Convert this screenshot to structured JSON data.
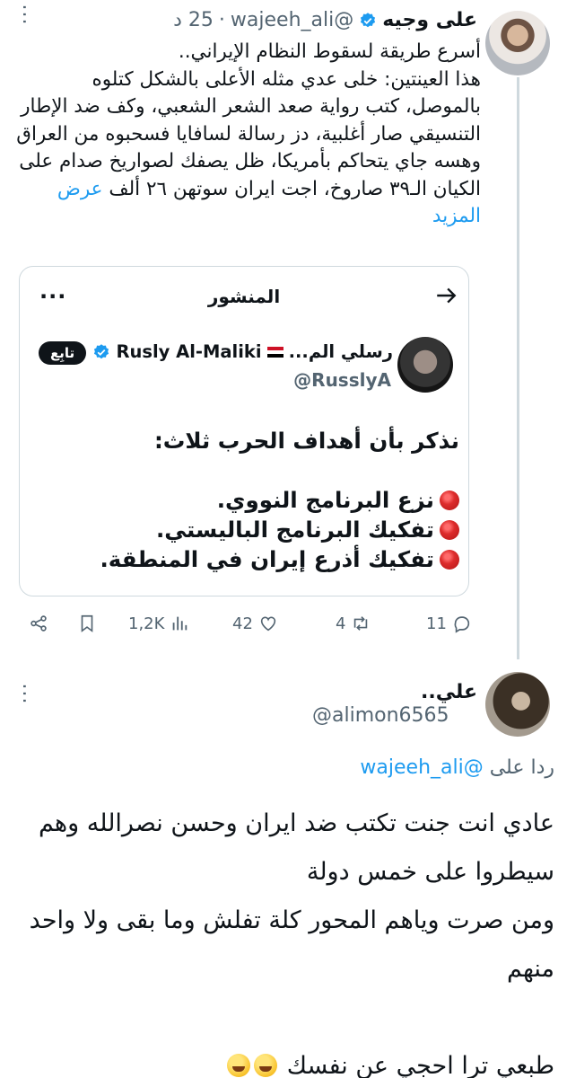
{
  "tweet1": {
    "display_name": "على وجيه",
    "handle": "@wajeeh_ali",
    "separator": "·",
    "time": "25 د",
    "body": "أسرع طريقة لسقوط النظام الإيراني..\nهذا العينتين: خلى عدي مثله الأعلى بالشكل كتلوه بالموصل، كتب رواية صعد الشعر الشعبي، وكف ضد الإطار التنسيقي صار أغلبية، دز رسالة لسافايا فسحبوه من العراق وهسه جاي يتحاكم بأمريكا، ظل يصفك لصواريخ صدام على الكيان الـ٣٩ صاروخ، اجت ايران سوتهن ٢٦ ألف",
    "show_more": "عرض المزيد",
    "quote": {
      "header_title": "المنشور",
      "display_name_ar": "رسلي الم...",
      "display_name_en": "Rusly Al-Maliki",
      "handle": "@RusslyA",
      "follow_label": "تابِع",
      "intro": "نذكر بأن أهداف الحرب ثلاث:",
      "goals": [
        "نزع البرنامج النووي.",
        "تفكيك البرنامج الباليستي.",
        "تفكيك أذرع إيران في المنطقة."
      ]
    },
    "actions": {
      "replies": "11",
      "reposts": "4",
      "likes": "42",
      "views": "1,2K"
    }
  },
  "tweet2": {
    "display_name": "علي..",
    "handle": "@alimon6565",
    "reply_prefix": "ردا على",
    "reply_mention": "@wajeeh_ali",
    "line1": "عادي انت جنت تكتب ضد ايران وحسن نصرالله وهم سيطروا على خمس دولة",
    "line2": "ومن صرت وياهم المحور كلة تفلش وما بقى ولا واحد منهم",
    "line3": "طبعي ترا احجي عن نفسك"
  },
  "icons": {
    "verified": "verified-badge-icon",
    "back": "arrow-icon",
    "more": "more-icon",
    "share": "share-icon",
    "bookmark": "bookmark-icon",
    "views": "views-icon",
    "like": "heart-icon",
    "repost": "repost-icon",
    "reply": "reply-icon",
    "emoji": "rofl-emoji-icon"
  },
  "colors": {
    "link": "#1d9bf0",
    "text": "#0f1419",
    "secondary": "#536471",
    "border": "#cfd9de"
  }
}
